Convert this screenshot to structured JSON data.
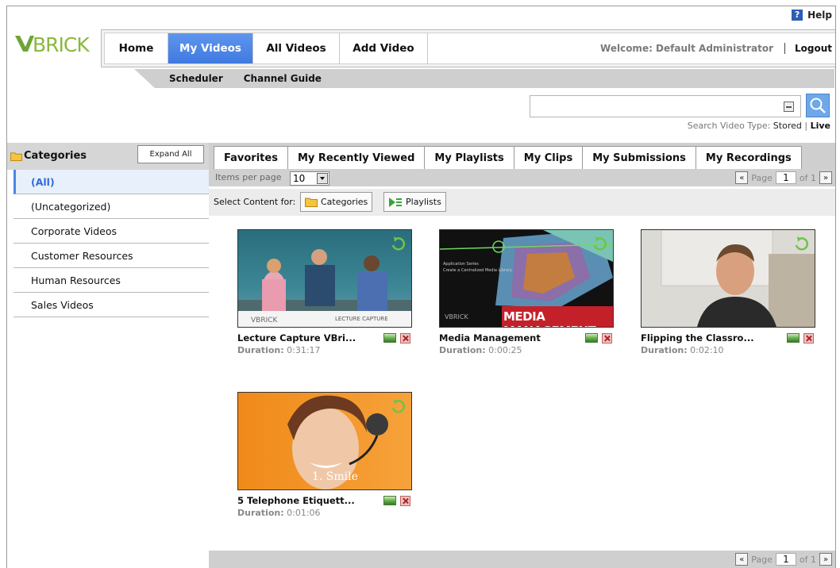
{
  "help": {
    "icon": "?",
    "label": "Help"
  },
  "logo": {
    "text": "VBRICK"
  },
  "nav": {
    "items": [
      {
        "label": "Home",
        "active": false
      },
      {
        "label": "My Videos",
        "active": true
      },
      {
        "label": "All Videos",
        "active": false
      },
      {
        "label": "Add Video",
        "active": false
      }
    ],
    "welcome": "Welcome: Default Administrator",
    "logout": "Logout"
  },
  "subnav": {
    "items": [
      "Scheduler",
      "Channel Guide"
    ]
  },
  "search": {
    "value": "",
    "type_label": "Search Video Type:",
    "stored": "Stored",
    "separator": "|",
    "live": "Live"
  },
  "categories": {
    "title": "Categories",
    "expand_all": "Expand All",
    "items": [
      "(All)",
      "(Uncategorized)",
      "Corporate Videos",
      "Customer Resources",
      "Human Resources",
      "Sales Videos"
    ],
    "selected_index": 0
  },
  "tabs": [
    "Favorites",
    "My Recently Viewed",
    "My Playlists",
    "My Clips",
    "My Submissions",
    "My Recordings"
  ],
  "active_tab": 0,
  "paging": {
    "items_per_page_label": "Items per page",
    "items_per_page": "10",
    "prev": "«",
    "page_label": "Page",
    "page": "1",
    "of_label": "of 1",
    "next": "»"
  },
  "select_content": {
    "label": "Select Content for:",
    "categories": "Categories",
    "playlists": "Playlists"
  },
  "videos": [
    {
      "title": "Lecture Capture VBri...",
      "duration_label": "Duration:",
      "duration": "0:31:17",
      "thumb_text": "LECTURE CAPTURE"
    },
    {
      "title": "Media Management",
      "duration_label": "Duration:",
      "duration": "0:00:25",
      "thumb_text": "MEDIA MANAGEMENT"
    },
    {
      "title": "Flipping the Classro...",
      "duration_label": "Duration:",
      "duration": "0:02:10",
      "thumb_text": ""
    },
    {
      "title": "5 Telephone Etiquett...",
      "duration_label": "Duration:",
      "duration": "0:01:06",
      "thumb_text": "1. Smile"
    }
  ],
  "colors": {
    "accent": "#4a86e8",
    "bar_gray": "#d0d0d0",
    "logo_green": "#8ab840"
  }
}
